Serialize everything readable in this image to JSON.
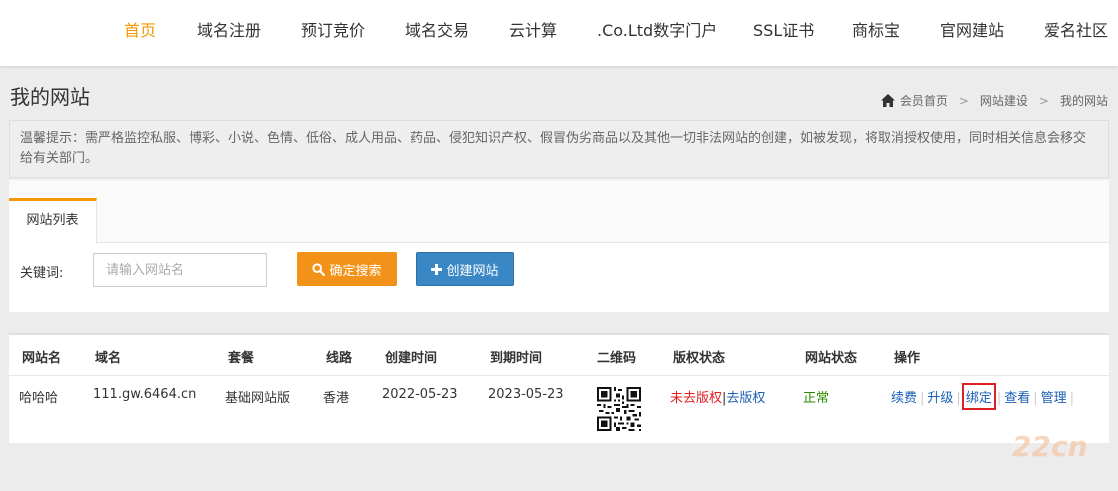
{
  "nav": [
    {
      "label": "首页",
      "active": true
    },
    {
      "label": "域名注册"
    },
    {
      "label": "预订竞价"
    },
    {
      "label": "域名交易"
    },
    {
      "label": "云计算"
    },
    {
      "label": ".Co.Ltd数字门户"
    },
    {
      "label": "SSL证书"
    },
    {
      "label": "商标宝"
    },
    {
      "label": "官网建站"
    },
    {
      "label": "爱名社区"
    }
  ],
  "page_title": "我的网站",
  "breadcrumb": {
    "home": "会员首页",
    "sep": ">",
    "middle": "网站建设",
    "current": "我的网站"
  },
  "notice": "温馨提示：需严格监控私服、博彩、小说、色情、低俗、成人用品、药品、侵犯知识产权、假冒伪劣商品以及其他一切非法网站的创建，如被发现，将取消授权使用，同时相关信息会移交给有关部门。",
  "tab": "网站列表",
  "search": {
    "label": "关键词:",
    "placeholder": "请输入网站名",
    "search_button": "确定搜索",
    "create_button": "创建网站"
  },
  "table": {
    "headers": [
      "网站名",
      "域名",
      "套餐",
      "线路",
      "创建时间",
      "到期时间",
      "二维码",
      "版权状态",
      "网站状态",
      "操作"
    ],
    "row": {
      "name": "哈哈哈",
      "domain": "111.gw.6464.cn",
      "plan": "基础网站版",
      "line": "香港",
      "created": "2022-05-23",
      "expires": "2023-05-23",
      "copyright_a": "未去版权",
      "copyright_sep": "|",
      "copyright_b": "去版权",
      "status": "正常",
      "ops": [
        "续费",
        "升级",
        "绑定",
        "查看",
        "管理"
      ]
    }
  },
  "colors": {
    "accent": "#f39800",
    "search_btn": "#f39218",
    "create_btn": "#3a87c6",
    "link": "#1a5fb4",
    "red": "#e02020",
    "green": "#2a8c00"
  },
  "watermark": "22cn"
}
